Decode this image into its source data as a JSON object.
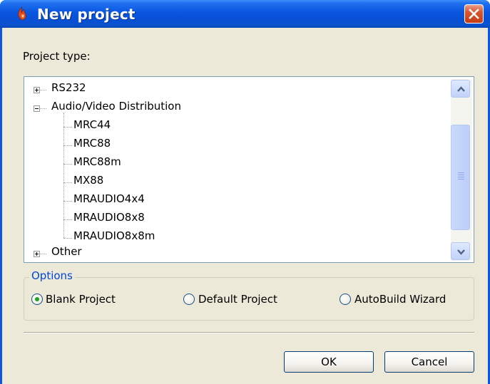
{
  "window": {
    "title": "New project",
    "close_label": "Close"
  },
  "project_type_label": "Project type:",
  "tree": {
    "nodes": [
      {
        "label": "RS232",
        "expanded": false
      },
      {
        "label": "Audio/Video Distribution",
        "expanded": true,
        "children": [
          "MRC44",
          "MRC88",
          "MRC88m",
          "MX88",
          "MRAUDIO4x4",
          "MRAUDIO8x8",
          "MRAUDIO8x8m"
        ]
      },
      {
        "label": "Other",
        "expanded": false
      }
    ]
  },
  "options": {
    "legend": "Options",
    "radios": [
      {
        "label": "Blank Project",
        "checked": true
      },
      {
        "label": "Default Project",
        "checked": false
      },
      {
        "label": "AutoBuild Wizard",
        "checked": false
      }
    ]
  },
  "buttons": {
    "ok": "OK",
    "cancel": "Cancel"
  },
  "colors": {
    "titlebar": "#0a56e0",
    "client": "#ece9d8",
    "legend_text": "#0046d5",
    "radio_dot": "#21a121"
  },
  "icons": {
    "app": "flame-app-icon",
    "close": "close-x-icon",
    "scroll_up": "arrow-up-icon",
    "scroll_down": "arrow-down-icon"
  }
}
